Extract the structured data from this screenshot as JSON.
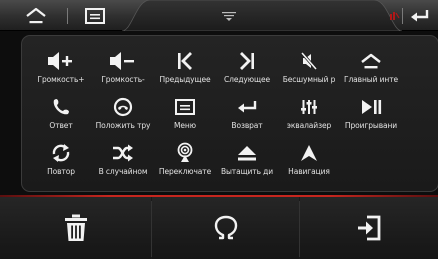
{
  "top_bar": {
    "home_icon": "home-icon",
    "menu_icon": "menu-icon",
    "handle_icon": "drawer-handle-icon",
    "back_icon": "back-arrow-icon"
  },
  "panel": {
    "rows": [
      [
        {
          "icon": "volume-up-icon",
          "label": "Громкость+"
        },
        {
          "icon": "volume-down-icon",
          "label": "Громкость-"
        },
        {
          "icon": "previous-icon",
          "label": "Предыдущее"
        },
        {
          "icon": "next-icon",
          "label": "Следующее"
        },
        {
          "icon": "mute-icon",
          "label": "Бесшумный р"
        },
        {
          "icon": "home-icon",
          "label": "Главный инте"
        }
      ],
      [
        {
          "icon": "answer-call-icon",
          "label": "Ответ"
        },
        {
          "icon": "hang-up-icon",
          "label": "Положить тру"
        },
        {
          "icon": "menu-icon",
          "label": "Меню"
        },
        {
          "icon": "return-icon",
          "label": "Возврат"
        },
        {
          "icon": "equalizer-icon",
          "label": "эквалайзер"
        },
        {
          "icon": "play-pause-icon",
          "label": "Проигрывани"
        }
      ],
      [
        {
          "icon": "repeat-icon",
          "label": "Повтор"
        },
        {
          "icon": "shuffle-icon",
          "label": "В случайном"
        },
        {
          "icon": "source-switch-icon",
          "label": "Переключате"
        },
        {
          "icon": "eject-icon",
          "label": "Вытащить ди"
        },
        {
          "icon": "navigation-icon",
          "label": "Навигация"
        }
      ]
    ]
  },
  "bottom_bar": {
    "buttons": [
      {
        "icon": "trash-icon"
      },
      {
        "icon": "omega-icon"
      },
      {
        "icon": "import-icon"
      }
    ]
  },
  "colors": {
    "accent_red": "#c7261e",
    "status_red": "#b01818",
    "icon_white": "#f2f2f2"
  }
}
